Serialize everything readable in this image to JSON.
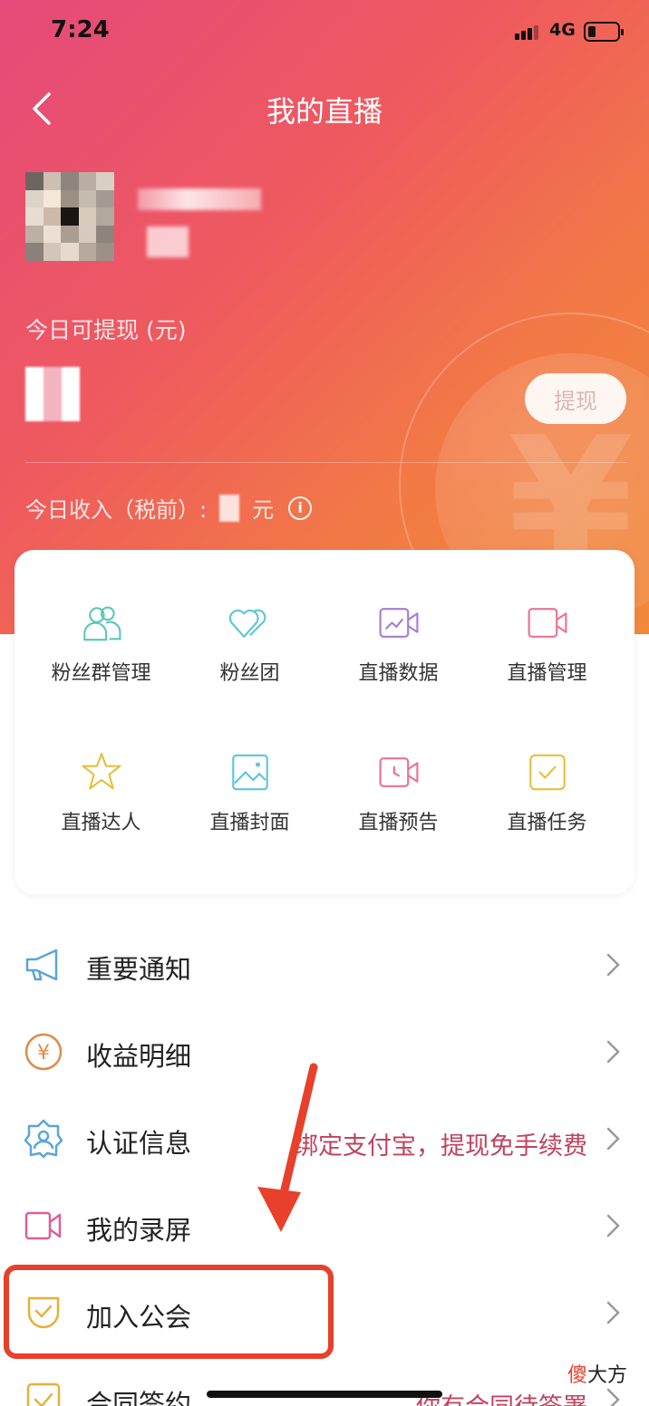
{
  "status_bar": {
    "time": "7:24",
    "network": "4G"
  },
  "nav": {
    "title": "我的直播"
  },
  "wallet": {
    "withdraw_label": "今日可提现 (元)",
    "withdraw_button": "提现",
    "income_prefix": "今日收入（税前）:",
    "income_unit": "元"
  },
  "grid": {
    "items": [
      {
        "label": "粉丝群管理",
        "icon": "fans-group-icon",
        "color": "#5cc7b8"
      },
      {
        "label": "粉丝团",
        "icon": "hearts-icon",
        "color": "#5cc7d6"
      },
      {
        "label": "直播数据",
        "icon": "video-chart-icon",
        "color": "#a77ad9"
      },
      {
        "label": "直播管理",
        "icon": "video-camera-icon",
        "color": "#e9738f"
      },
      {
        "label": "直播达人",
        "icon": "star-icon",
        "color": "#e6c03c"
      },
      {
        "label": "直播封面",
        "icon": "image-icon",
        "color": "#5cc7d6"
      },
      {
        "label": "直播预告",
        "icon": "video-clock-icon",
        "color": "#e9738f"
      },
      {
        "label": "直播任务",
        "icon": "task-check-icon",
        "color": "#e6c03c"
      }
    ]
  },
  "list": {
    "items": [
      {
        "label": "重要通知",
        "hint": "",
        "icon": "megaphone-icon"
      },
      {
        "label": "收益明细",
        "hint": "",
        "icon": "yen-icon"
      },
      {
        "label": "认证信息",
        "hint": "绑定支付宝，提现免手续费",
        "icon": "verified-user-icon"
      },
      {
        "label": "我的录屏",
        "hint": "",
        "icon": "screen-record-icon"
      },
      {
        "label": "加入公会",
        "hint": "",
        "icon": "shield-check-icon"
      },
      {
        "label": "合同签约",
        "hint": "你有合同待签署",
        "icon": "contract-check-icon"
      }
    ]
  },
  "watermark": {
    "part1": "傻",
    "part2": "大方"
  },
  "colors": {
    "highlight": "#e8402b",
    "hint": "#c0435f"
  }
}
